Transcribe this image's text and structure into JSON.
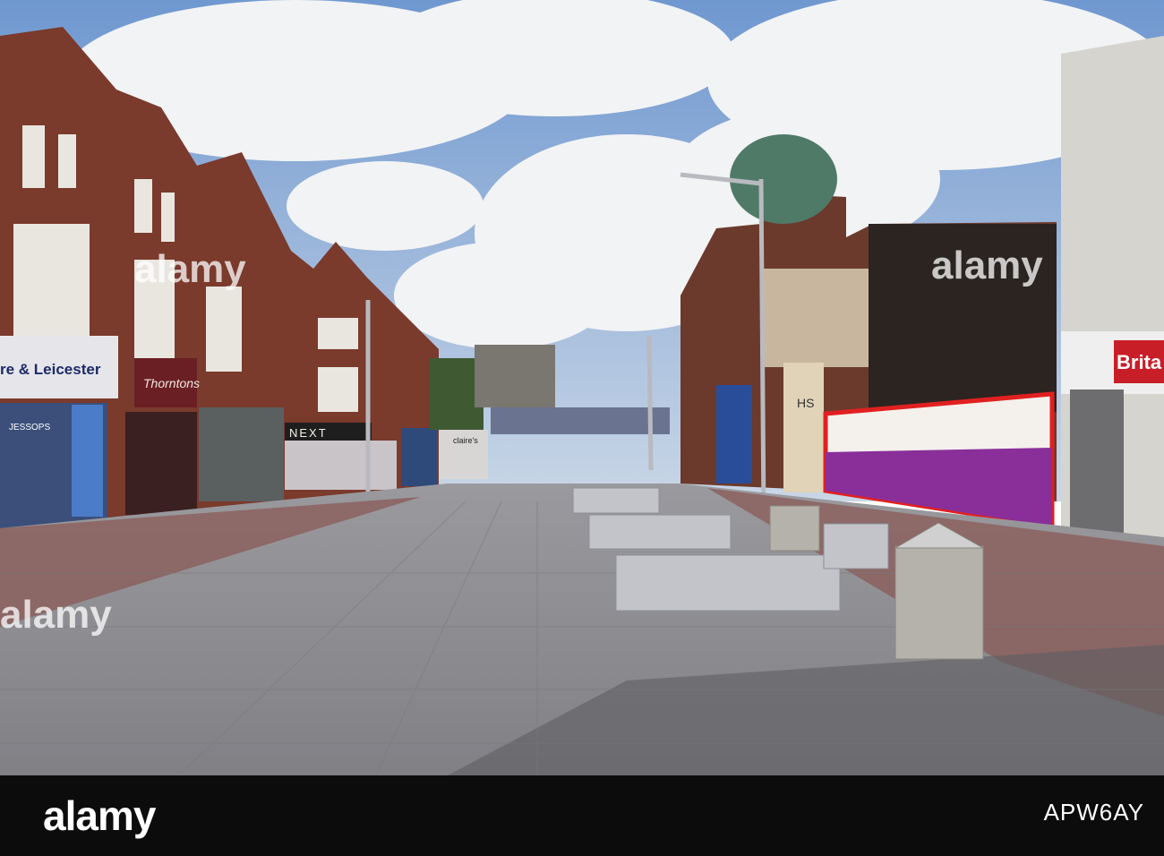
{
  "watermark": {
    "brand": "alamy",
    "image_code": "APW6AY"
  },
  "signs": {
    "bank": "re & Leicester",
    "camera_shop": "JESSOPS",
    "chocolatier": "Thorntons",
    "fashion": "NEXT",
    "accessories": "claire's",
    "store_hs": "HS",
    "right_bank": "Brita"
  },
  "colors": {
    "sky": "#7fa6d8",
    "brick": "#7a3a2c",
    "pavement": "#8d8d92",
    "hoarding": "#8a2f9a"
  }
}
